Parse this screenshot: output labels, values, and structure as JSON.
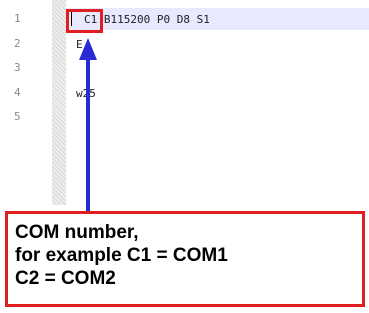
{
  "editor": {
    "line_numbers": [
      "1",
      "2",
      "3",
      "4",
      "5"
    ],
    "lines": [
      "C1 B115200 P0 D8 S1",
      "E",
      "",
      "w25",
      ""
    ]
  },
  "callout": {
    "lines": [
      "COM number,",
      "for example C1 = COM1",
      "C2 = COM2"
    ]
  },
  "colors": {
    "highlight_border": "#e02020",
    "arrow": "#2b2bd6",
    "current_line_bg": "#e8e8ff"
  }
}
